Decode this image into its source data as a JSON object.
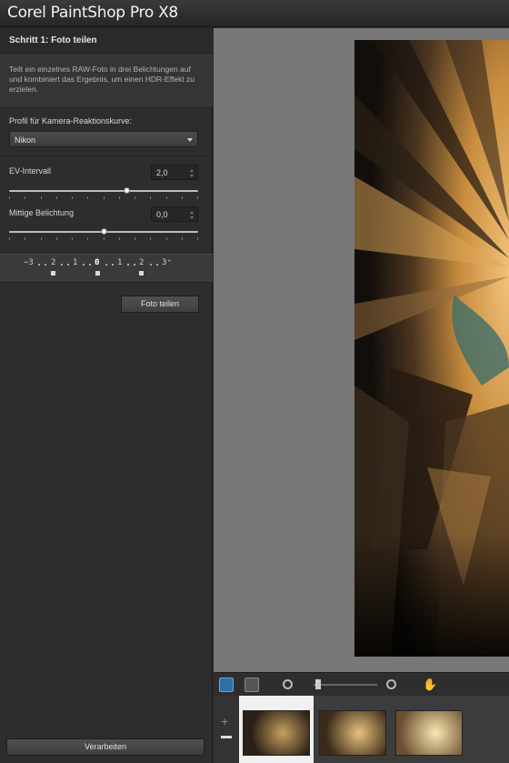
{
  "app": {
    "title": "Corel PaintShop Pro X8"
  },
  "panel": {
    "step_title": "Schritt 1: Foto teilen",
    "description": "Teilt ein einzelnes RAW-Foto in drei Belichtungen auf und kombiniert das Ergebnis, um einen HDR-Effekt zu erzielen.",
    "profile_label": "Profil für Kamera-Reaktionskurve:",
    "profile_value": "Nikon",
    "ev_label": "EV-Intervall",
    "ev_value": "2,0",
    "ev_level_fraction": 0.62,
    "mid_label": "Mittige Belichtung",
    "mid_value": "0,0",
    "mid_level_fraction": 0.5,
    "exposure_scale": {
      "minus": "−3",
      "m2": "2",
      "m1": "1",
      "zero": "0",
      "p1": "1",
      "p2": "2",
      "plus": "3⁺"
    },
    "split_button": "Foto teilen",
    "process_button": "Verarbeiten"
  },
  "toolbar": {
    "icons": [
      "fit-window-icon",
      "actual-size-icon",
      "zoom-out-icon",
      "zoom-slider",
      "zoom-in-icon",
      "pan-hand-icon"
    ]
  },
  "filmstrip": {
    "add": "+",
    "thumbnails": [
      "exposure-1",
      "exposure-2",
      "exposure-3"
    ],
    "selected_index": 0
  },
  "colors": {
    "accent": "#4a90d9",
    "panel": "#2d2d2d",
    "canvas": "#777777"
  }
}
